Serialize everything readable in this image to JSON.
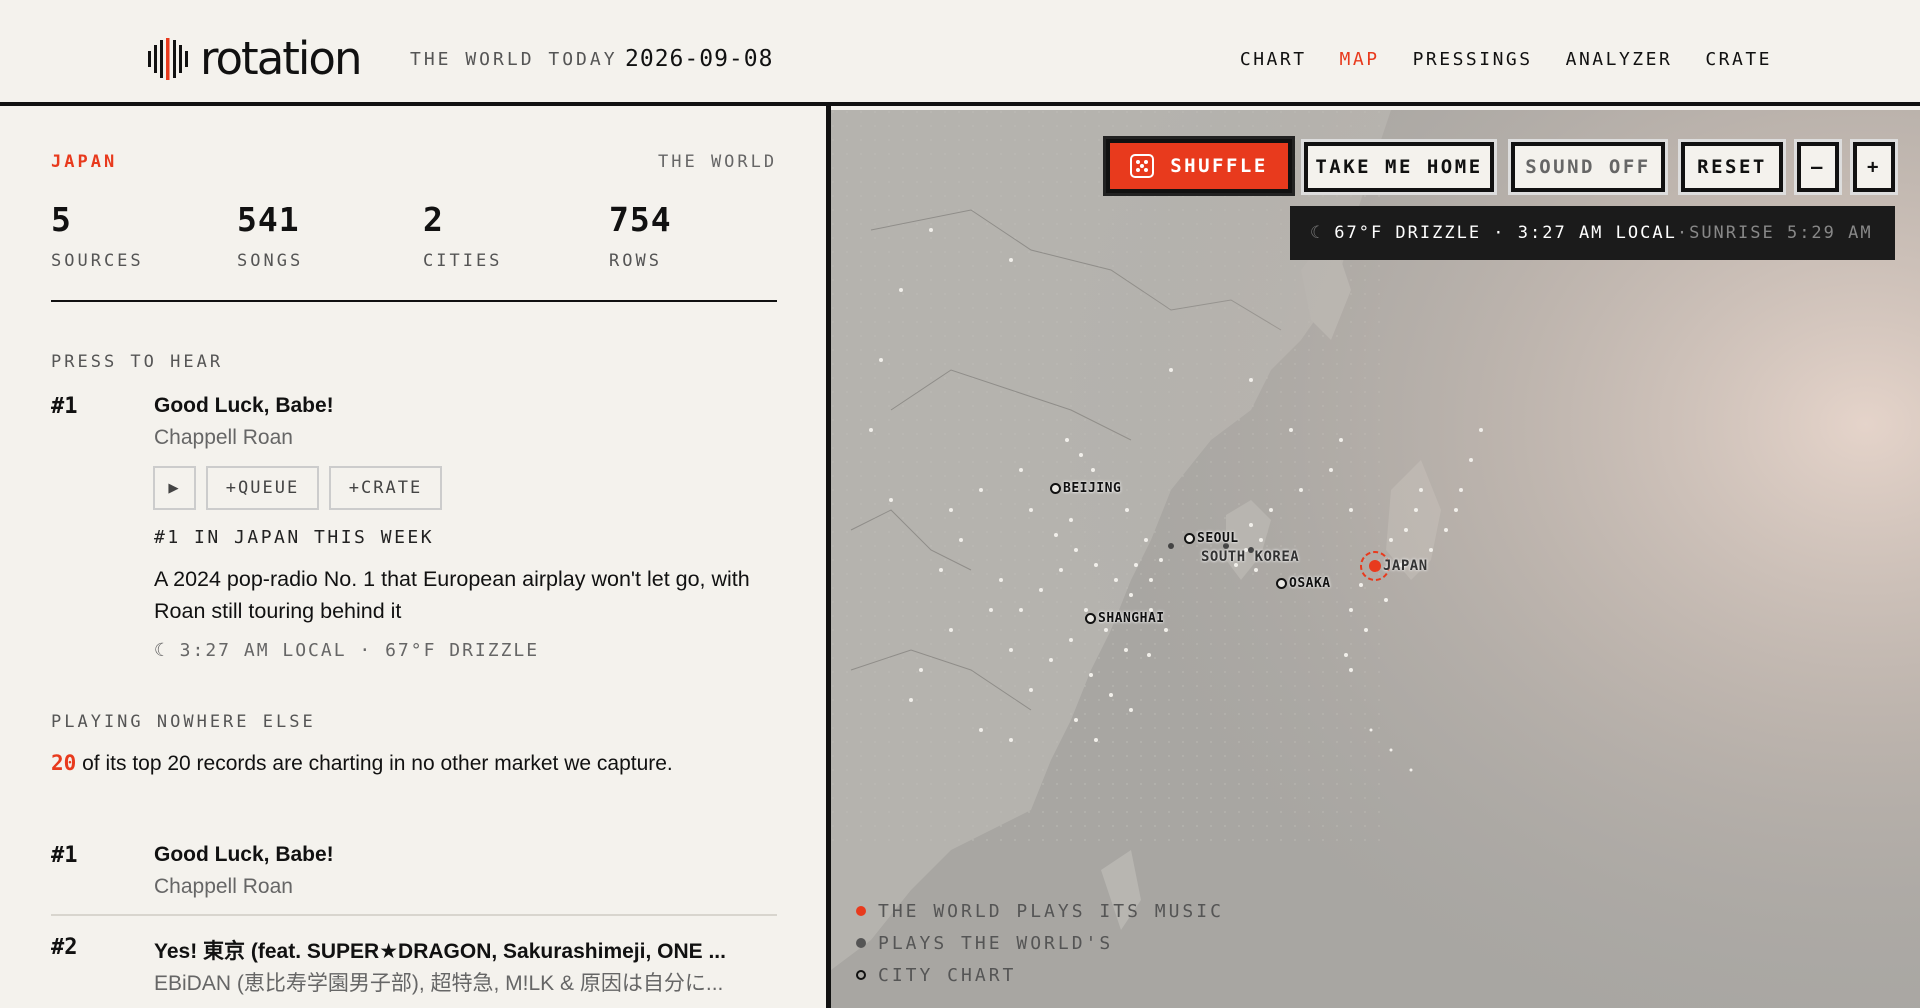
{
  "header": {
    "brand": "rotation",
    "tagline": "THE WORLD TODAY",
    "date": "2026-09-08",
    "nav": [
      {
        "label": "CHART",
        "active": false
      },
      {
        "label": "MAP",
        "active": true
      },
      {
        "label": "PRESSINGS",
        "active": false
      },
      {
        "label": "ANALYZER",
        "active": false
      },
      {
        "label": "CRATE",
        "active": false
      }
    ]
  },
  "panel": {
    "country": "JAPAN",
    "world_label": "THE WORLD",
    "stats": [
      {
        "value": "5",
        "label": "SOURCES"
      },
      {
        "value": "541",
        "label": "SONGS"
      },
      {
        "value": "2",
        "label": "CITIES"
      },
      {
        "value": "754",
        "label": "ROWS"
      }
    ],
    "press_title": "PRESS TO HEAR",
    "featured": {
      "rank": "#1",
      "title": "Good Luck, Babe!",
      "artist": "Chappell Roan",
      "play_label": "▶",
      "queue_label": "+QUEUE",
      "crate_label": "+CRATE",
      "week_line": "#1 IN JAPAN THIS WEEK",
      "blurb": "A 2024 pop-radio No. 1 that European airplay won't let go, with Roan still touring behind it",
      "local_line": "☾ 3:27 AM LOCAL · 67°F DRIZZLE"
    },
    "nowhere_title": "PLAYING NOWHERE ELSE",
    "nowhere_count": "20",
    "nowhere_text": " of its top 20 records are charting in no other market we capture.",
    "list": [
      {
        "rank": "#1",
        "title": "Good Luck, Babe!",
        "artist": "Chappell Roan"
      },
      {
        "rank": "#2",
        "title": "Yes! 東京 (feat. SUPER★DRAGON, Sakurashimeji, ONE ...",
        "artist": "EBiDAN (恵比寿学園男子部), 超特急, M!LK & 原因は自分に..."
      }
    ]
  },
  "map": {
    "shuffle_label": "SHUFFLE",
    "home_label": "TAKE ME HOME",
    "sound_label": "SOUND OFF",
    "reset_label": "RESET",
    "zoom_out_label": "–",
    "zoom_in_label": "+",
    "weather": {
      "moon": "☾",
      "main": "67°F DRIZZLE · 3:27 AM LOCAL",
      "sep": " · ",
      "sunrise": "SUNRISE 5:29 AM"
    },
    "cities": {
      "beijing": "BEIJING",
      "seoul": "SEOUL",
      "south_korea": "SOUTH KOREA",
      "japan": "JAPAN",
      "osaka": "OSAKA",
      "shanghai": "SHANGHAI"
    },
    "legend": [
      {
        "label": "THE WORLD PLAYS ITS MUSIC",
        "color": "#e83a1d"
      },
      {
        "label": "PLAYS THE WORLD'S",
        "color": "#555555"
      },
      {
        "label": "CITY CHART",
        "color": "#ffffff"
      }
    ],
    "accent": "#e83a1d"
  }
}
